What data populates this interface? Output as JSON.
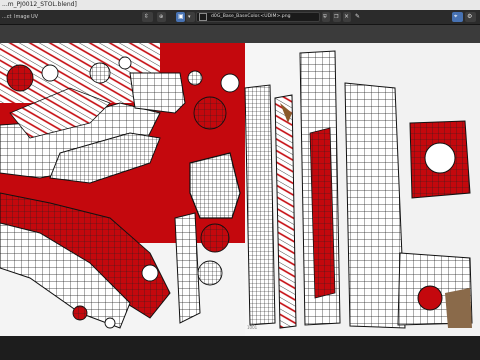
{
  "window": {
    "title": "...m_PJ0012_STOL.blend]"
  },
  "menu": {
    "items": [
      "...ct",
      "Image",
      "UV"
    ]
  },
  "image": {
    "name": "d0G_Base_BaseColor.<UDIM>.png"
  },
  "viewport": {
    "label": "1001"
  },
  "colors": {
    "texture_red": "#c4080d",
    "header_bg": "#2b2b2b",
    "accent_blue": "#4772b3",
    "viewport_bg": "#f4f4f4"
  }
}
